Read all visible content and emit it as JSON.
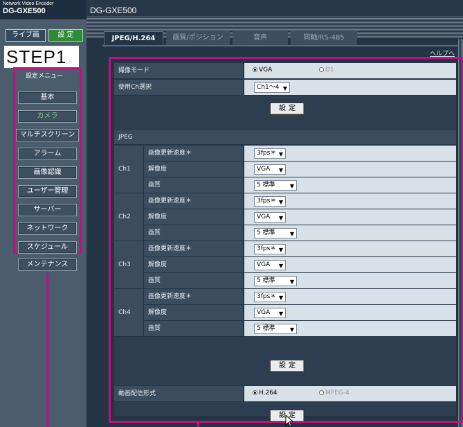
{
  "header": {
    "brand_sub": "Network Video Encoder",
    "brand_main": "DG-GXE500",
    "model": "DG-GXE500"
  },
  "sidebar": {
    "mode_live": "ライブ画",
    "mode_setup": "設 定",
    "step_label": "STEP1",
    "menu_title": "設定メニュー",
    "items": [
      {
        "label": "基本"
      },
      {
        "label": "カメラ"
      },
      {
        "label": "マルチスクリーン"
      },
      {
        "label": "アラーム"
      },
      {
        "label": "画像認識"
      },
      {
        "label": "ユーザー管理"
      },
      {
        "label": "サーバー"
      },
      {
        "label": "ネットワーク"
      },
      {
        "label": "スケジュール"
      },
      {
        "label": "メンテナンス"
      }
    ]
  },
  "tabs": [
    {
      "label": "JPEG/H.264"
    },
    {
      "label": "画質/ポジション"
    },
    {
      "label": "音声"
    },
    {
      "label": "同軸/RS-485"
    }
  ],
  "help_link": "ヘルプへ",
  "form": {
    "capture_mode_label": "撮像モード",
    "capture_mode_options": [
      "VGA",
      "D1"
    ],
    "ch_select_label": "使用Ch選択",
    "ch_select_value": "Ch1〜4",
    "set_button": "設定",
    "jpeg_section": "JPEG",
    "channels": [
      {
        "name": "Ch1",
        "refresh_label": "画像更新速度＊",
        "refresh_value": "3fps＊",
        "resolution_label": "解像度",
        "resolution_value": "VGA",
        "quality_label": "画質",
        "quality_value": "5 標準"
      },
      {
        "name": "Ch2",
        "refresh_label": "画像更新速度＊",
        "refresh_value": "3fps＊",
        "resolution_label": "解像度",
        "resolution_value": "VGA",
        "quality_label": "画質",
        "quality_value": "5 標準"
      },
      {
        "name": "Ch3",
        "refresh_label": "画像更新速度＊",
        "refresh_value": "3fps＊",
        "resolution_label": "解像度",
        "resolution_value": "VGA",
        "quality_label": "画質",
        "quality_value": "5 標準"
      },
      {
        "name": "Ch4",
        "refresh_label": "画像更新速度＊",
        "refresh_value": "3fps＊",
        "resolution_label": "解像度",
        "resolution_value": "VGA",
        "quality_label": "画質",
        "quality_value": "5 標準"
      }
    ],
    "stream_format_label": "動画配信形式",
    "stream_format_options": [
      "H.264",
      "MPEG-4"
    ]
  },
  "colors": {
    "accent_frame": "#c4107e",
    "active_setup": "#2f8a3a",
    "active_menu_text": "#7fcf7f"
  }
}
